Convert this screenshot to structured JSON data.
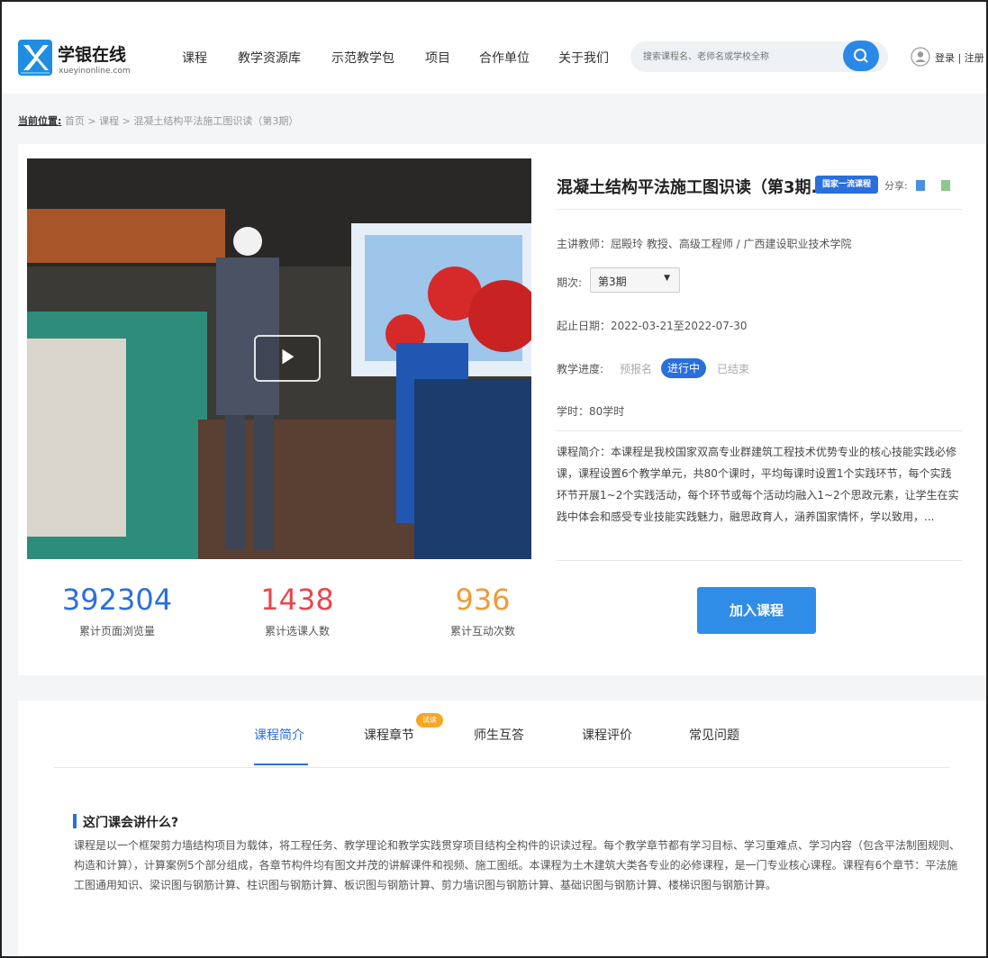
{
  "header": {
    "logo_name": "学银在线",
    "logo_sub": "xueyinonline.com",
    "nav": [
      "课程",
      "教学资源库",
      "示范教学包",
      "项目",
      "合作单位",
      "关于我们"
    ],
    "search_placeholder": "搜索课程名、老师名或学校全称",
    "login_label": "登录 | 注册"
  },
  "breadcrumb": {
    "current_label": "当前位置:",
    "path": "首页 > 课程 > 混凝土结构平法施工图识读（第3期）"
  },
  "course": {
    "title": "混凝土结构平法施工图识读（第3期...",
    "tag": "国家一流课程",
    "share_label": "分享:",
    "teacher": "主讲教师：屈殿玲 教授、高级工程师 / 广西建设职业技术学院",
    "term_label": "期次:",
    "term_value": "第3期",
    "dates": "起止日期：2022-03-21至2022-07-30",
    "progress_label": "教学进度:",
    "progress_states": [
      "预报名",
      "进行中",
      "已结束"
    ],
    "hours": "学时：80学时",
    "intro": "课程简介：本课程是我校国家双高专业群建筑工程技术优势专业的核心技能实践必修课，课程设置6个教学单元，共80个课时，平均每课时设置1个实践环节，每个实践环节开展1~2个实践活动，每个环节或每个活动均融入1~2个思政元素，让学生在实践中体会和感受专业技能实践魅力，融思政育人，涵养国家情怀，学以致用，..."
  },
  "stats": [
    {
      "value": "392304",
      "label": "累计页面浏览量",
      "color": "#2a6fdc"
    },
    {
      "value": "1438",
      "label": "累计选课人数",
      "color": "#e8474c"
    },
    {
      "value": "936",
      "label": "累计互动次数",
      "color": "#f09a36"
    }
  ],
  "join_button": "加入课程",
  "tabs": [
    "课程简介",
    "课程章节",
    "师生互答",
    "课程评价",
    "常见问题"
  ],
  "tab_badge": "试读",
  "section": {
    "title": "这门课会讲什么?",
    "body": "课程是以一个框架剪力墙结构项目为载体，将工程任务、教学理论和教学实践贯穿项目结构全构件的识读过程。每个教学章节都有学习目标、学习重难点、学习内容（包含平法制图规则、构造和计算），计算案例5个部分组成，各章节构件均有图文并茂的讲解课件和视频、施工图纸。本课程为土木建筑大类各专业的必修课程，是一门专业核心课程。课程有6个章节：平法施工图通用知识、梁识图与钢筋计算、柱识图与钢筋计算、板识图与钢筋计算、剪力墙识图与钢筋计算、基础识图与钢筋计算、楼梯识图与钢筋计算。"
  },
  "colors": {
    "primary": "#2a6fdc",
    "accent_button": "#2f8de8"
  }
}
